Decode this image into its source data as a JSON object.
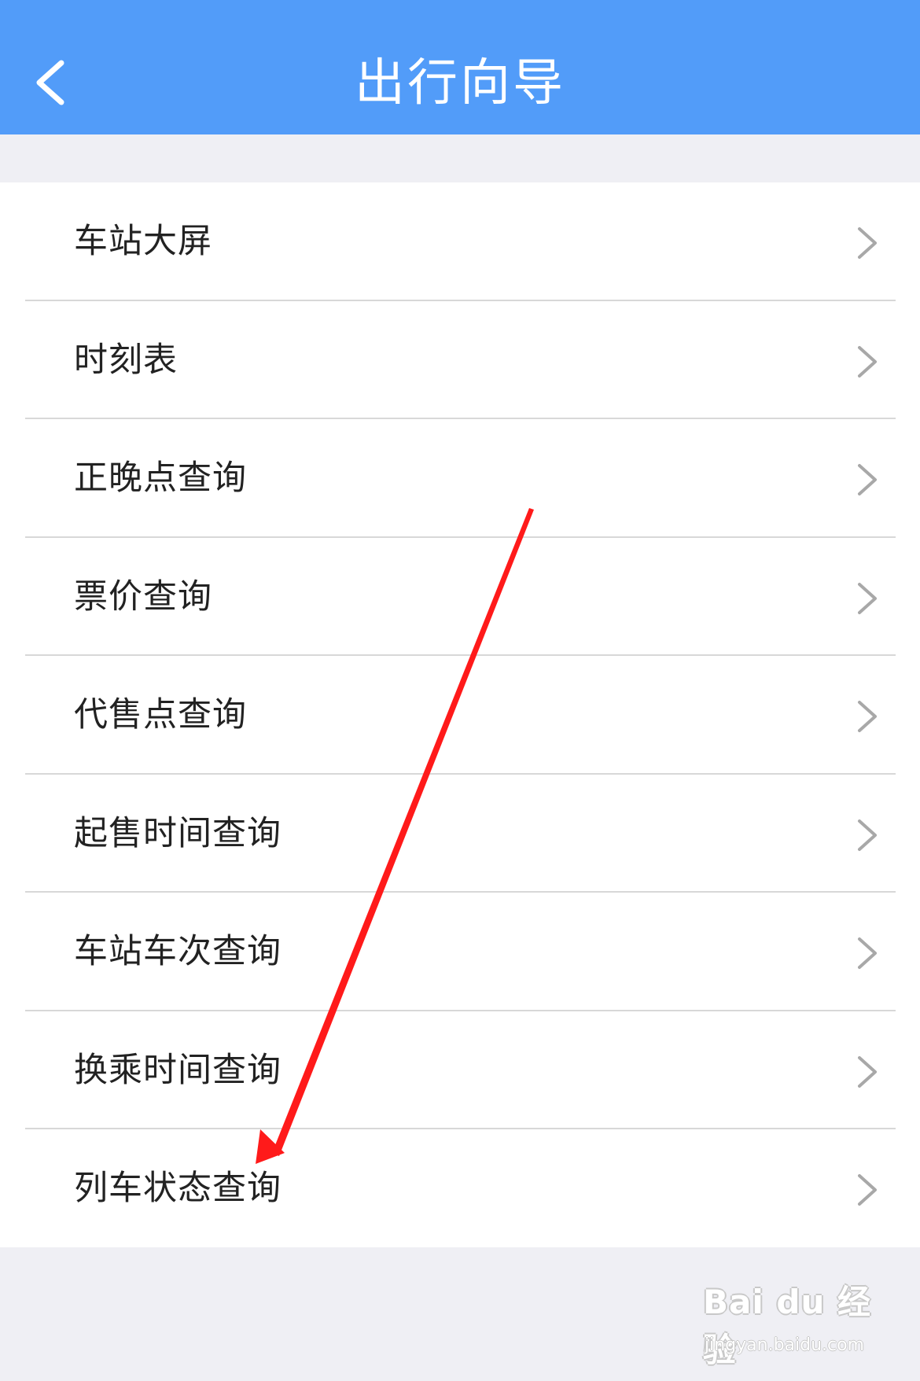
{
  "header": {
    "title": "出行向导",
    "back_icon": "chevron-left-icon",
    "background_color": "#529cf9"
  },
  "menu": {
    "items": [
      {
        "label": "车站大屏"
      },
      {
        "label": "时刻表"
      },
      {
        "label": "正晚点查询"
      },
      {
        "label": "票价查询"
      },
      {
        "label": "代售点查询"
      },
      {
        "label": "起售时间查询"
      },
      {
        "label": "车站车次查询"
      },
      {
        "label": "换乘时间查询"
      },
      {
        "label": "列车状态查询"
      }
    ],
    "chevron_icon": "chevron-right-icon"
  },
  "annotation": {
    "arrow_icon": "red-arrow-pointer",
    "arrow_color": "#ff1a1a",
    "points_to": "列车状态查询"
  },
  "watermark": {
    "logo_text": "Bai du 经验",
    "url": "jingyan.baidu.com"
  }
}
